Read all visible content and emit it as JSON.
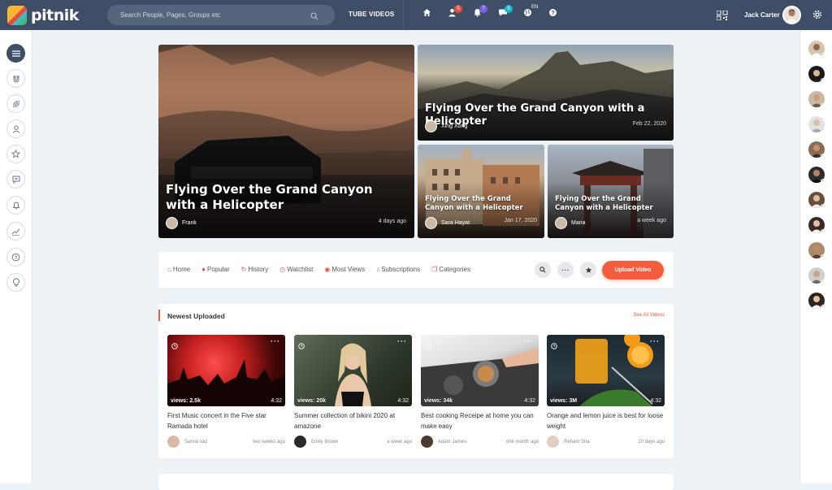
{
  "app": {
    "name": "pitnik"
  },
  "header": {
    "search_placeholder": "Search People, Pages, Groups etc",
    "tube_label": "TUBE VIDEOS",
    "badges": {
      "friends": "5",
      "notifications": "7",
      "messages": "9"
    },
    "language": "EN",
    "user_name": "Jack Carter"
  },
  "hero": {
    "main": {
      "title": "Flying Over the Grand Canyon with a Helicopter",
      "author": "Frank",
      "date": "4 days ago"
    },
    "top_right": {
      "title": "Flying Over the Grand Canyon with a Helicopter",
      "author": "Xing Xong",
      "date": "Feb 22, 2020"
    },
    "bottom_left": {
      "title": "Flying Over the Grand Canyon with a Helicopter",
      "author": "Sara Hayat",
      "date": "Jan 17, 2020"
    },
    "bottom_right": {
      "title": "Flying Over the Grand Canyon with a Helicopter",
      "author": "Maria",
      "date": "a week ago"
    }
  },
  "nav": {
    "items": [
      {
        "label": "Home",
        "icon": "home-icon"
      },
      {
        "label": "Popular",
        "icon": "fire-icon"
      },
      {
        "label": "History",
        "icon": "history-icon"
      },
      {
        "label": "Watchlist",
        "icon": "clock-icon"
      },
      {
        "label": "Most Views",
        "icon": "eye-icon"
      },
      {
        "label": "Subscriptions",
        "icon": "bell-icon"
      },
      {
        "label": "Categories",
        "icon": "copy-icon"
      }
    ],
    "upload_label": "Upload Video"
  },
  "newest": {
    "title": "Newest Uploaded",
    "see_all": "See All Videos",
    "videos": [
      {
        "views": "views: 2.5k",
        "duration": "4:32",
        "title": "First Music concert in the Five star Ramada hotel",
        "author": "Samia naz",
        "ago": "two weeks ago"
      },
      {
        "views": "views: 20k",
        "duration": "4:32",
        "title": "Summer collection of bikini 2020 at amazone",
        "author": "Emily Brown",
        "ago": "a week ago"
      },
      {
        "views": "views: 34k",
        "duration": "4:32",
        "title": "Best cooking Receipe at home you can make easy",
        "author": "Adam James",
        "ago": "one month ago"
      },
      {
        "views": "views: 3M",
        "duration": "4:32",
        "title": "Orange and lemon juice is best for loose weight",
        "author": "Reham Sha",
        "ago": "20 days ago"
      }
    ]
  },
  "colors": {
    "accent": "#f35c3d",
    "topbar": "#3d4e66",
    "online": "#4caf50",
    "away": "#f7b733"
  }
}
